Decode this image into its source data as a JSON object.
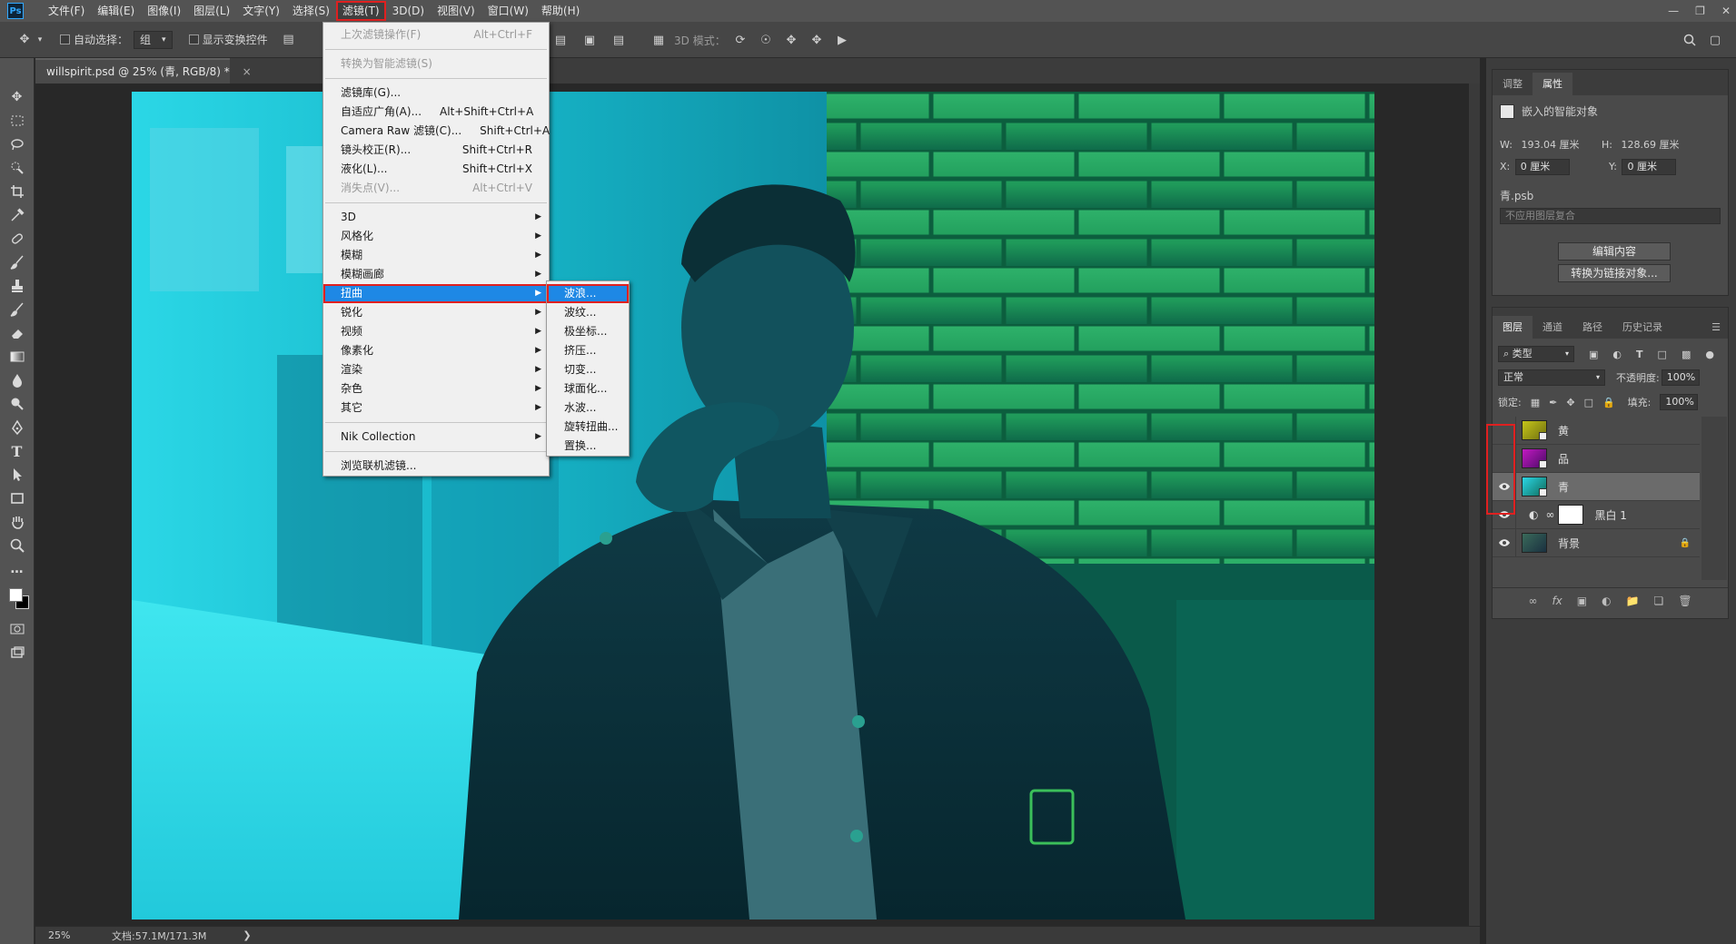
{
  "app": {
    "logo": "Ps"
  },
  "menubar": {
    "items": [
      "文件(F)",
      "编辑(E)",
      "图像(I)",
      "图层(L)",
      "文字(Y)",
      "选择(S)",
      "滤镜(T)",
      "3D(D)",
      "视图(V)",
      "窗口(W)",
      "帮助(H)"
    ],
    "active_index": 6
  },
  "options_bar": {
    "auto_select_label": "自动选择：",
    "auto_select_value": "组",
    "show_transform_label": "显示变换控件",
    "mode_3d_label": "3D 模式："
  },
  "document": {
    "tab_title": "willspirit.psd @ 25% (青, RGB/8) *",
    "close_glyph": "×",
    "zoom": "25%",
    "doc_size": "文档:57.1M/171.3M"
  },
  "filter_menu": {
    "items": [
      {
        "label": "上次滤镜操作(F)",
        "shortcut": "Alt+Ctrl+F",
        "disabled": true
      },
      {
        "sep": true
      },
      {
        "label": "转换为智能滤镜(S)",
        "disabled": true
      },
      {
        "sep": true
      },
      {
        "label": "滤镜库(G)..."
      },
      {
        "label": "自适应广角(A)...",
        "shortcut": "Alt+Shift+Ctrl+A"
      },
      {
        "label": "Camera Raw 滤镜(C)...",
        "shortcut": "Shift+Ctrl+A"
      },
      {
        "label": "镜头校正(R)...",
        "shortcut": "Shift+Ctrl+R"
      },
      {
        "label": "液化(L)...",
        "shortcut": "Shift+Ctrl+X"
      },
      {
        "label": "消失点(V)...",
        "shortcut": "Alt+Ctrl+V",
        "disabled": true
      },
      {
        "sep": true
      },
      {
        "label": "3D",
        "submenu": true
      },
      {
        "label": "风格化",
        "submenu": true
      },
      {
        "label": "模糊",
        "submenu": true
      },
      {
        "label": "模糊画廊",
        "submenu": true
      },
      {
        "label": "扭曲",
        "submenu": true,
        "highlight": true
      },
      {
        "label": "锐化",
        "submenu": true
      },
      {
        "label": "视频",
        "submenu": true
      },
      {
        "label": "像素化",
        "submenu": true
      },
      {
        "label": "渲染",
        "submenu": true
      },
      {
        "label": "杂色",
        "submenu": true
      },
      {
        "label": "其它",
        "submenu": true
      },
      {
        "sep": true
      },
      {
        "label": "Nik Collection",
        "submenu": true
      },
      {
        "sep": true
      },
      {
        "label": "浏览联机滤镜..."
      }
    ]
  },
  "distort_submenu": {
    "items": [
      {
        "label": "波浪...",
        "highlight": true
      },
      {
        "label": "波纹..."
      },
      {
        "label": "极坐标..."
      },
      {
        "label": "挤压..."
      },
      {
        "label": "切变..."
      },
      {
        "label": "球面化..."
      },
      {
        "label": "水波..."
      },
      {
        "label": "旋转扭曲..."
      },
      {
        "label": "置换..."
      }
    ]
  },
  "properties_panel": {
    "tabs": [
      "调整",
      "属性"
    ],
    "active_tab": 1,
    "type_label": "嵌入的智能对象",
    "w_label": "W:",
    "w_value": "193.04 厘米",
    "h_label": "H:",
    "h_value": "128.69 厘米",
    "x_label": "X:",
    "x_value": "0 厘米",
    "y_label": "Y:",
    "y_value": "0 厘米",
    "file_name": "青.psb",
    "comp_placeholder": "不应用图层复合",
    "edit_contents": "编辑内容",
    "convert_linked": "转换为链接对象..."
  },
  "layers_panel": {
    "tabs": [
      "图层",
      "通道",
      "路径",
      "历史记录"
    ],
    "active_tab": 0,
    "filter_kind": "类型",
    "blend_mode": "正常",
    "opacity_label": "不透明度:",
    "opacity_value": "100%",
    "lock_label": "锁定:",
    "fill_label": "填充:",
    "fill_value": "100%",
    "layers": [
      {
        "name": "黄",
        "visible": false,
        "thumb": "#c6c61a"
      },
      {
        "name": "品",
        "visible": false,
        "thumb": "#b41ab4"
      },
      {
        "name": "青",
        "visible": true,
        "selected": true,
        "thumb": "#1ab4b4"
      },
      {
        "name": "黑白 1",
        "visible": true,
        "adjustment": true
      },
      {
        "name": "背景",
        "visible": true,
        "locked": true,
        "thumb": "#3a6a5a"
      }
    ]
  },
  "colors": {
    "accent_blue": "#1e88e5",
    "highlight_red": "#e02020"
  }
}
